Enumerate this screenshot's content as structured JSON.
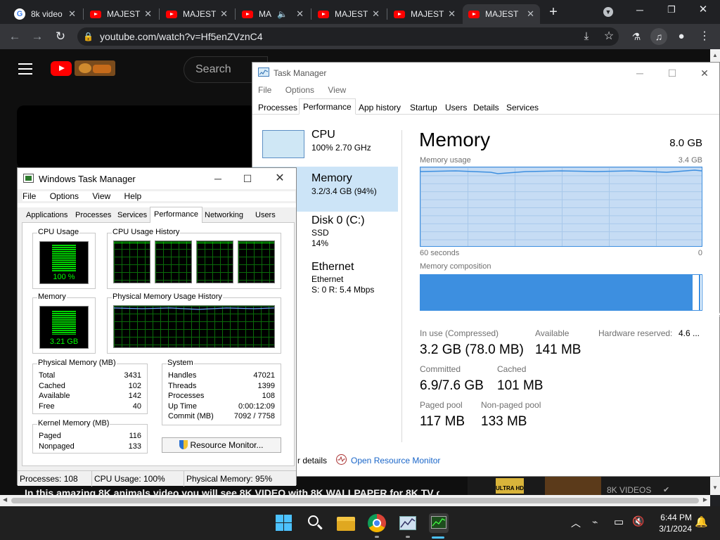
{
  "browser": {
    "tabs": [
      {
        "title": "8k video",
        "fav": "google"
      },
      {
        "title": "MAJEST",
        "fav": "youtube"
      },
      {
        "title": "MAJEST",
        "fav": "youtube"
      },
      {
        "title": "MA",
        "fav": "youtube",
        "audio": true
      },
      {
        "title": "MAJEST",
        "fav": "youtube"
      },
      {
        "title": "MAJEST",
        "fav": "youtube"
      },
      {
        "title": "MAJEST",
        "fav": "youtube",
        "active": true
      }
    ],
    "url": "youtube.com/watch?v=Hf5enZVznC4"
  },
  "youtube": {
    "search_placeholder": "Search",
    "caption": "In this amazing 8K animals video you will see 8K VIDEO with 8K WALLPAPER for 8K TV cute",
    "thumb_badge": "ULTRA HD",
    "thumb_channel": "8K VIDEOS"
  },
  "old_tm": {
    "title": "Windows Task Manager",
    "menu": [
      "File",
      "Options",
      "View",
      "Help"
    ],
    "tabs": [
      "Applications",
      "Processes",
      "Services",
      "Performance",
      "Networking",
      "Users"
    ],
    "active_tab": "Performance",
    "cpu_usage_label": "CPU Usage",
    "cpu_usage_value": "100 %",
    "cpu_history_label": "CPU Usage History",
    "memory_label": "Memory",
    "memory_value": "3.21 GB",
    "phys_history_label": "Physical Memory Usage History",
    "physical_memory": {
      "label": "Physical Memory (MB)",
      "rows": [
        [
          "Total",
          "3431"
        ],
        [
          "Cached",
          "102"
        ],
        [
          "Available",
          "142"
        ],
        [
          "Free",
          "40"
        ]
      ]
    },
    "kernel_memory": {
      "label": "Kernel Memory (MB)",
      "rows": [
        [
          "Paged",
          "116"
        ],
        [
          "Nonpaged",
          "133"
        ]
      ]
    },
    "system": {
      "label": "System",
      "rows": [
        [
          "Handles",
          "47021"
        ],
        [
          "Threads",
          "1399"
        ],
        [
          "Processes",
          "108"
        ],
        [
          "Up Time",
          "0:00:12:09"
        ],
        [
          "Commit (MB)",
          "7092 / 7758"
        ]
      ]
    },
    "resource_monitor_button": "Resource Monitor...",
    "status": {
      "processes": "Processes: 108",
      "cpu": "CPU Usage: 100%",
      "memory": "Physical Memory: 95%"
    }
  },
  "new_tm": {
    "title": "Task Manager",
    "menu": [
      "File",
      "Options",
      "View"
    ],
    "tabs": [
      "Processes",
      "Performance",
      "App history",
      "Startup",
      "Users",
      "Details",
      "Services"
    ],
    "active_tab": "Performance",
    "sidebar": [
      {
        "name": "CPU",
        "sub1": "100%  2.70 GHz",
        "sub2": ""
      },
      {
        "name": "Memory",
        "sub1": "3.2/3.4 GB (94%)",
        "sub2": "",
        "selected": true
      },
      {
        "name": "Disk 0 (C:)",
        "sub1": "SSD",
        "sub2": "14%"
      },
      {
        "name": "Ethernet",
        "sub1": "Ethernet",
        "sub2": "S: 0  R: 5.4 Mbps"
      }
    ],
    "heading": "Memory",
    "total": "8.0 GB",
    "usage_label": "Memory usage",
    "usage_max": "3.4 GB",
    "time_left": "60 seconds",
    "time_right": "0",
    "composition_label": "Memory composition",
    "stats": {
      "in_use_label": "In use (Compressed)",
      "in_use_value": "3.2 GB (78.0 MB)",
      "available_label": "Available",
      "available_value": "141 MB",
      "hw_reserved_label": "Hardware reserved:",
      "hw_reserved_value": "4.6 ...",
      "committed_label": "Committed",
      "committed_value": "6.9/7.6 GB",
      "cached_label": "Cached",
      "cached_value": "101 MB",
      "paged_label": "Paged pool",
      "paged_value": "117 MB",
      "nonpaged_label": "Non-paged pool",
      "nonpaged_value": "133 MB"
    },
    "fewer_details": "r details",
    "open_resource_monitor": "Open Resource Monitor"
  },
  "taskbar": {
    "time": "6:44 PM",
    "date": "3/1/2024"
  },
  "colors": {
    "chrome_dark": "#202124",
    "chrome_toolbar": "#35363a",
    "yt_red": "#ff0000",
    "meter_green": "#00ff00",
    "mem_blue": "#3d8fe0",
    "mem_fill": "#c6dcf4",
    "link_blue": "#1a66c9"
  }
}
